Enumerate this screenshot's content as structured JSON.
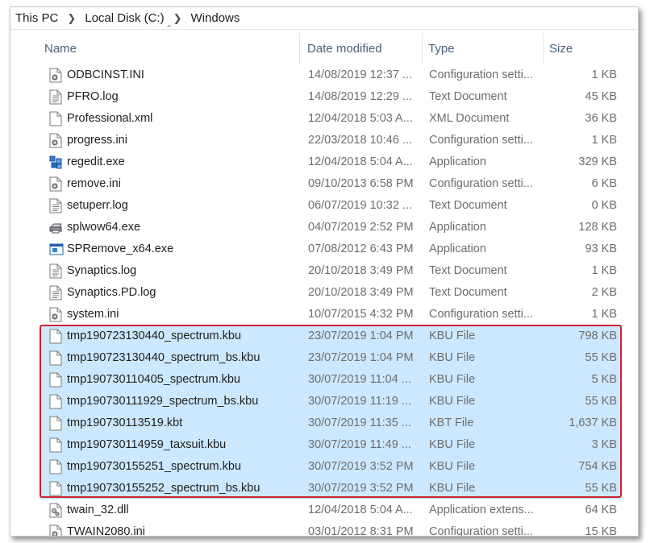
{
  "breadcrumb": {
    "items": [
      "This PC",
      "Local Disk (C:)",
      "Windows"
    ]
  },
  "columns": {
    "name": "Name",
    "date": "Date modified",
    "type": "Type",
    "size": "Size"
  },
  "files": [
    {
      "name": "ODBCINST.INI",
      "date": "14/08/2019 12:37 ...",
      "type": "Configuration setti...",
      "size": "1 KB",
      "icon": "config-file-icon",
      "selected": false
    },
    {
      "name": "PFRO.log",
      "date": "14/08/2019 12:29 ...",
      "type": "Text Document",
      "size": "45 KB",
      "icon": "text-file-icon",
      "selected": false
    },
    {
      "name": "Professional.xml",
      "date": "12/04/2018 5:03 A...",
      "type": "XML Document",
      "size": "36 KB",
      "icon": "blank-file-icon",
      "selected": false
    },
    {
      "name": "progress.ini",
      "date": "22/03/2018 10:46 ...",
      "type": "Configuration setti...",
      "size": "1 KB",
      "icon": "config-file-icon",
      "selected": false
    },
    {
      "name": "regedit.exe",
      "date": "12/04/2018 5:04 A...",
      "type": "Application",
      "size": "329 KB",
      "icon": "regedit-icon",
      "selected": false
    },
    {
      "name": "remove.ini",
      "date": "09/10/2013 6:58 PM",
      "type": "Configuration setti...",
      "size": "6 KB",
      "icon": "config-file-icon",
      "selected": false
    },
    {
      "name": "setuperr.log",
      "date": "06/07/2019 10:32 ...",
      "type": "Text Document",
      "size": "0 KB",
      "icon": "text-file-icon",
      "selected": false
    },
    {
      "name": "splwow64.exe",
      "date": "04/07/2019 2:52 PM",
      "type": "Application",
      "size": "128 KB",
      "icon": "printer-icon",
      "selected": false
    },
    {
      "name": "SPRemove_x64.exe",
      "date": "07/08/2012 6:43 PM",
      "type": "Application",
      "size": "93 KB",
      "icon": "app-window-icon",
      "selected": false
    },
    {
      "name": "Synaptics.log",
      "date": "20/10/2018 3:49 PM",
      "type": "Text Document",
      "size": "1 KB",
      "icon": "text-file-icon",
      "selected": false
    },
    {
      "name": "Synaptics.PD.log",
      "date": "20/10/2018 3:49 PM",
      "type": "Text Document",
      "size": "2 KB",
      "icon": "text-file-icon",
      "selected": false
    },
    {
      "name": "system.ini",
      "date": "10/07/2015 4:32 PM",
      "type": "Configuration setti...",
      "size": "1 KB",
      "icon": "config-file-icon",
      "selected": false
    },
    {
      "name": "tmp190723130440_spectrum.kbu",
      "date": "23/07/2019 1:04 PM",
      "type": "KBU File",
      "size": "798 KB",
      "icon": "blank-file-icon",
      "selected": true
    },
    {
      "name": "tmp190723130440_spectrum_bs.kbu",
      "date": "23/07/2019 1:04 PM",
      "type": "KBU File",
      "size": "55 KB",
      "icon": "blank-file-icon",
      "selected": true
    },
    {
      "name": "tmp190730110405_spectrum.kbu",
      "date": "30/07/2019 11:04 ...",
      "type": "KBU File",
      "size": "5 KB",
      "icon": "blank-file-icon",
      "selected": true
    },
    {
      "name": "tmp190730111929_spectrum_bs.kbu",
      "date": "30/07/2019 11:19 ...",
      "type": "KBU File",
      "size": "55 KB",
      "icon": "blank-file-icon",
      "selected": true
    },
    {
      "name": "tmp190730113519.kbt",
      "date": "30/07/2019 11:35 ...",
      "type": "KBT File",
      "size": "1,637 KB",
      "icon": "blank-file-icon",
      "selected": true
    },
    {
      "name": "tmp190730114959_taxsuit.kbu",
      "date": "30/07/2019 11:49 ...",
      "type": "KBU File",
      "size": "3 KB",
      "icon": "blank-file-icon",
      "selected": true
    },
    {
      "name": "tmp190730155251_spectrum.kbu",
      "date": "30/07/2019 3:52 PM",
      "type": "KBU File",
      "size": "754 KB",
      "icon": "blank-file-icon",
      "selected": true
    },
    {
      "name": "tmp190730155252_spectrum_bs.kbu",
      "date": "30/07/2019 3:52 PM",
      "type": "KBU File",
      "size": "55 KB",
      "icon": "blank-file-icon",
      "selected": true
    },
    {
      "name": "twain_32.dll",
      "date": "12/04/2018 5:04 A...",
      "type": "Application extens...",
      "size": "64 KB",
      "icon": "dll-file-icon",
      "selected": false
    },
    {
      "name": "TWAIN2080.ini",
      "date": "03/01/2012 8:31 PM",
      "type": "Configuration setti...",
      "size": "15 KB",
      "icon": "config-file-icon",
      "selected": false
    }
  ],
  "colors": {
    "selection": "#cce8ff",
    "annotation_border": "#d0202f",
    "header_text": "#4c607a"
  }
}
